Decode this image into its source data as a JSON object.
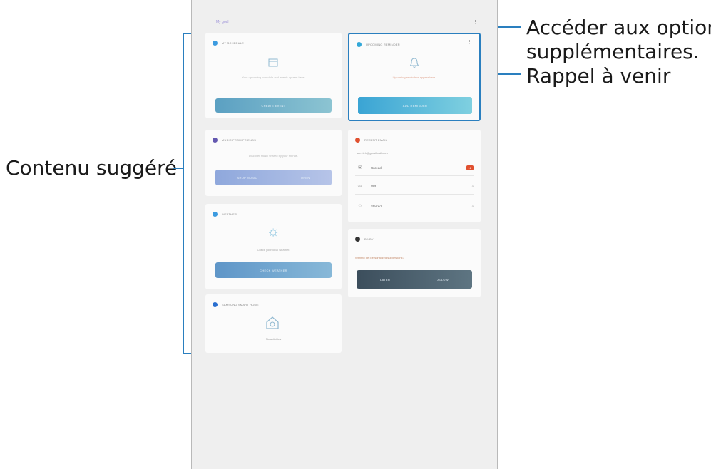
{
  "callouts": {
    "more_options_line1": "Accéder aux options",
    "more_options_line2": "supplémentaires.",
    "upcoming_reminder": "Rappel à venir",
    "suggested_content": "Contenu suggéré"
  },
  "screen": {
    "app_title": "My goal",
    "more_icon": "vertical-ellipsis-icon",
    "cards": {
      "schedule": {
        "title": "MY SCHEDULE",
        "text": "Your upcoming schedule and events appear here.",
        "button": "CREATE EVENT",
        "color": "#3c9be0"
      },
      "reminder": {
        "title": "UPCOMING REMINDER",
        "text": "Upcoming reminders appear here.",
        "button": "ADD REMINDER",
        "color": "#33a8d8"
      },
      "music": {
        "title": "MUSIC FROM FRIENDS",
        "text": "Discover music shared by your friends.",
        "button_left": "SHOP MUSIC",
        "button_right": "OPEN",
        "color": "#6458b0"
      },
      "email": {
        "title": "RECENT EMAIL",
        "account": "sam.b.h@gmailmail.com",
        "rows": [
          {
            "icon": "envelope-icon",
            "label": "Unread",
            "badge": "12"
          },
          {
            "icon": "vip-icon",
            "label": "VIP",
            "count": "0"
          },
          {
            "icon": "star-icon",
            "label": "Starred",
            "count": "0"
          }
        ],
        "color": "#e0502f"
      },
      "weather": {
        "title": "WEATHER",
        "text": "Check your local weather.",
        "button": "CHECK WEATHER",
        "color": "#3c9be0"
      },
      "bixby": {
        "title": "BIXBY",
        "text": "Want to get personalized suggestions?",
        "button_left": "LATER",
        "button_right": "ALLOW",
        "color": "#333333"
      },
      "smart_home": {
        "title": "SAMSUNG SMART HOME",
        "text": "No activities",
        "color": "#2a6fd0"
      }
    }
  }
}
